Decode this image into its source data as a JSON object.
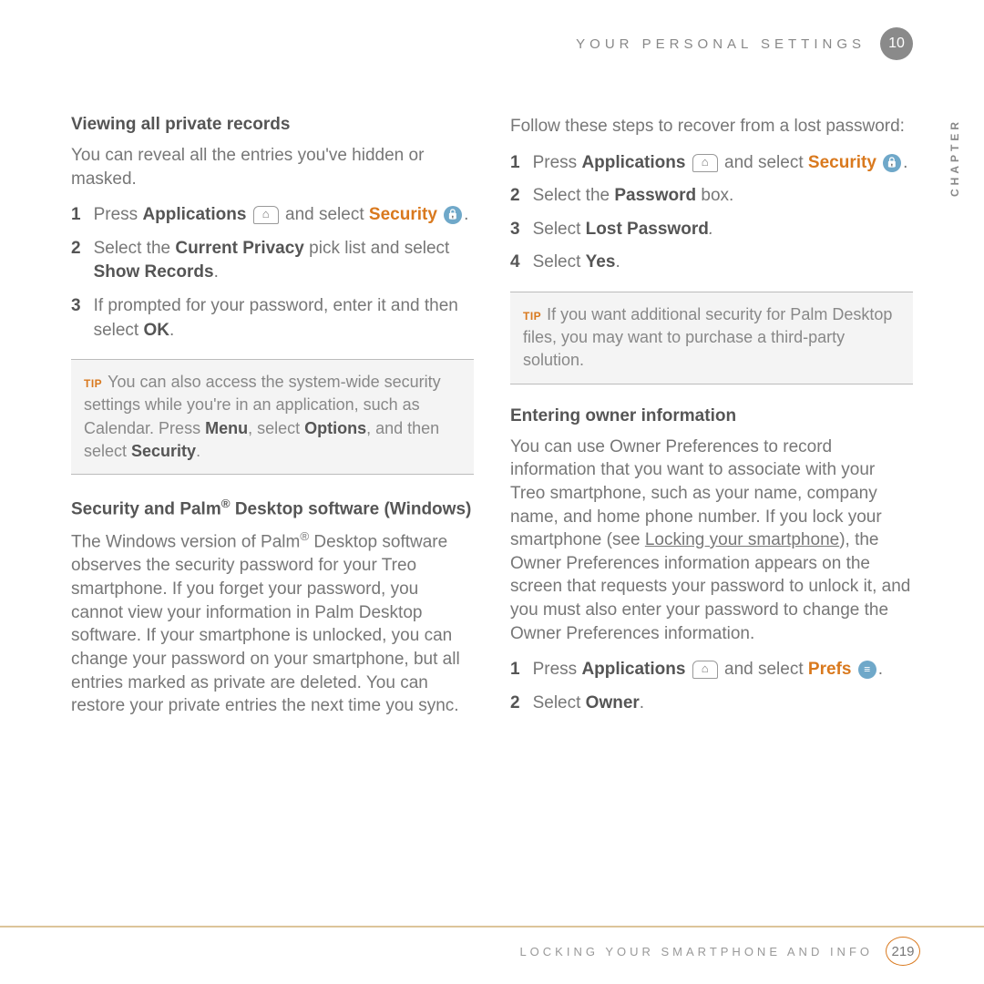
{
  "header": {
    "title": "YOUR PERSONAL SETTINGS",
    "chapter_num": "10",
    "chapter_side": "CHAPTER"
  },
  "left": {
    "h1": "Viewing all private records",
    "p1": "You can reveal all the entries you've hidden or masked.",
    "steps1": {
      "s1a": "Press ",
      "s1b": "Applications",
      "s1c": " and select ",
      "s1d": "Security",
      "s1e": ".",
      "s2a": "Select the ",
      "s2b": "Current Privacy",
      "s2c": " pick list and select ",
      "s2d": "Show Records",
      "s2e": ".",
      "s3a": "If prompted for your password, enter it and then select ",
      "s3b": "OK",
      "s3c": "."
    },
    "tip1": {
      "label": "TIP",
      "text_a": "You can also access the system-wide security settings while you're in an application, such as Calendar. Press ",
      "text_b": "Menu",
      "text_c": ", select ",
      "text_d": "Options",
      "text_e": ", and then select ",
      "text_f": "Security",
      "text_g": "."
    },
    "h2a": "Security and Palm",
    "h2b": " Desktop software (Windows)",
    "p2a": "The Windows version of Palm",
    "p2b": " Desktop software observes the security password for your Treo smartphone. If you forget your password, you cannot view your information in Palm Desktop software. If your smartphone is unlocked, you can change your password on your smartphone, but all entries marked as private are deleted. You can restore your private entries the next time you sync."
  },
  "right": {
    "p1": "Follow these steps to recover from a lost password:",
    "steps1": {
      "s1a": "Press ",
      "s1b": "Applications",
      "s1c": " and select ",
      "s1d": "Security",
      "s1e": ".",
      "s2a": "Select the ",
      "s2b": "Password",
      "s2c": " box.",
      "s3a": "Select ",
      "s3b": "Lost Password",
      "s3c": ".",
      "s4a": "Select ",
      "s4b": "Yes",
      "s4c": "."
    },
    "tip1": {
      "label": "TIP",
      "text": "If you want additional security for Palm Desktop files, you may want to purchase a third-party solution."
    },
    "h2": "Entering owner information",
    "p2a": "You can use Owner Preferences to record information that you want to associate with your Treo smartphone, such as your name, company name, and home phone number. If you lock your smartphone (see ",
    "p2link": "Locking your smartphone",
    "p2b": "), the Owner Preferences information appears on the screen that requests your password to unlock it, and you must also enter your password to change the Owner Preferences information.",
    "steps2": {
      "s1a": "Press ",
      "s1b": "Applications",
      "s1c": " and select ",
      "s1d": "Prefs",
      "s1e": ".",
      "s2a": "Select ",
      "s2b": "Owner",
      "s2c": "."
    }
  },
  "footer": {
    "label": "LOCKING YOUR SMARTPHONE AND INFO",
    "page": "219"
  }
}
